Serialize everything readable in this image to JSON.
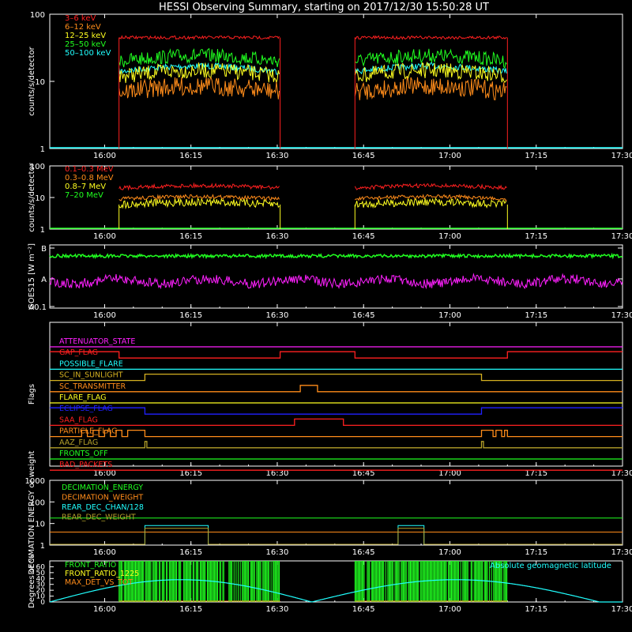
{
  "title": "HESSI Observing Summary, starting on 2017/12/30 15:50:28 UT",
  "colors": {
    "background": "#000000",
    "axes": "#ffffff",
    "red": "#ff2020",
    "orange": "#ff8c1a",
    "yellow": "#ffff20",
    "green": "#20ff20",
    "cyan": "#20ffff",
    "magenta": "#ff20ff",
    "blue": "#2020ff",
    "olive": "#b4a02a",
    "gold": "#d4b020"
  },
  "time_axis": {
    "range": [
      "15:50:28",
      "17:30"
    ],
    "tick_labels": [
      "16:00",
      "16:15",
      "16:30",
      "16:45",
      "17:00",
      "17:15",
      "17:30"
    ]
  },
  "chart_data": [
    {
      "id": "energy-lightcurves",
      "type": "line",
      "ylabel": "counts/s/detector",
      "yscale": "log",
      "ylim": [
        1,
        100
      ],
      "y_tick_labels": [
        "1",
        "10",
        "100"
      ],
      "time_intervals": [
        [
          "16:02:30",
          "16:30:30"
        ],
        [
          "16:43:30",
          "17:10:00"
        ]
      ],
      "series": [
        {
          "name": "3–6 keV",
          "color": "red",
          "level": 45
        },
        {
          "name": "6–12 keV",
          "color": "orange",
          "level": 7
        },
        {
          "name": "12–25 keV",
          "color": "yellow",
          "level": 12
        },
        {
          "name": "25–50 keV",
          "color": "green",
          "level": 20
        },
        {
          "name": "50–100 keV",
          "color": "cyan",
          "level": 14
        }
      ]
    },
    {
      "id": "mev-lightcurves",
      "type": "line",
      "ylabel": "counts/s/detector",
      "yscale": "log",
      "ylim": [
        1,
        100
      ],
      "y_tick_labels": [
        "1",
        "10",
        "100"
      ],
      "time_intervals": [
        [
          "16:02:30",
          "16:30:30"
        ],
        [
          "16:43:30",
          "17:10:00"
        ]
      ],
      "series": [
        {
          "name": "0.1–0.3 MeV",
          "color": "red",
          "level": 20
        },
        {
          "name": "0.3–0.8 MeV",
          "color": "orange",
          "level": 9
        },
        {
          "name": "0.8–7 MeV",
          "color": "yellow",
          "level": 6
        },
        {
          "name": "7–20 MeV",
          "color": "green",
          "level": 1
        }
      ]
    },
    {
      "id": "goes",
      "type": "line",
      "ylabel": "GOES15 [W m⁻²]",
      "y_tick_labels": [
        "A0.1",
        "A",
        "B"
      ],
      "series": [
        {
          "color": "green",
          "level": "B"
        },
        {
          "color": "magenta",
          "level": "A"
        }
      ]
    },
    {
      "id": "flags",
      "type": "line",
      "ylabel": "Flags",
      "rows": [
        {
          "name": "ATTENUATOR_STATE",
          "color": "magenta",
          "high": []
        },
        {
          "name": "GAP_FLAG",
          "color": "red",
          "high": [
            [
              "15:50:28",
              "16:02:30"
            ],
            [
              "16:30:30",
              "16:43:30"
            ],
            [
              "17:10:00",
              "17:30"
            ]
          ]
        },
        {
          "name": "POSSIBLE_FLARE",
          "color": "cyan",
          "high": []
        },
        {
          "name": "SC_IN_SUNLIGHT",
          "color": "gold",
          "high": [
            [
              "16:07:00",
              "17:05:30"
            ]
          ]
        },
        {
          "name": "SC_TRANSMITTER",
          "color": "orange",
          "high": [
            [
              "16:34:00",
              "16:37:00"
            ]
          ]
        },
        {
          "name": "FLARE_FLAG",
          "color": "yellow",
          "high": []
        },
        {
          "name": "ECLIPSE_FLAG",
          "color": "blue",
          "high": [
            [
              "15:50:28",
              "16:07:00"
            ],
            [
              "17:05:30",
              "17:30"
            ]
          ]
        },
        {
          "name": "SAA_FLAG",
          "color": "red",
          "high": [
            [
              "16:33:00",
              "16:41:30"
            ]
          ]
        },
        {
          "name": "PARTICLE_FLAG",
          "color": "orange",
          "high": [
            [
              "15:56:00",
              "15:57:00"
            ],
            [
              "15:58:00",
              "15:59:00"
            ],
            [
              "16:00:00",
              "16:01:00"
            ],
            [
              "16:02:00",
              "16:03:00"
            ],
            [
              "16:04:00",
              "16:07:00"
            ],
            [
              "17:05:30",
              "17:07:30"
            ],
            [
              "17:08:00",
              "17:09:00"
            ],
            [
              "17:09:30",
              "17:10:00"
            ]
          ]
        },
        {
          "name": "AAZ_FLAG",
          "color": "olive",
          "high": [
            [
              "16:07:00",
              "16:07:20"
            ],
            [
              "17:05:30",
              "17:05:50"
            ]
          ]
        },
        {
          "name": "FRONTS_OFF",
          "color": "green",
          "high": []
        },
        {
          "name": "BAD_PACKETS",
          "color": "red",
          "high": []
        }
      ]
    },
    {
      "id": "decimation",
      "type": "line",
      "ylabel": "DECIMATION ENERGY or weight",
      "yscale": "log",
      "ylim": [
        1,
        1000
      ],
      "y_tick_labels": [
        "1",
        "10",
        "100",
        "1000"
      ],
      "series": [
        {
          "name": "DECIMATION_ENERGY",
          "color": "green",
          "level": 18
        },
        {
          "name": "DECIMATION_WEIGHT",
          "color": "orange",
          "level": 4
        },
        {
          "name": "REAR_DEC_CHAN/128",
          "color": "cyan",
          "level": 8,
          "windows": [
            [
              "16:07:00",
              "16:18:00"
            ],
            [
              "16:51:00",
              "16:55:30"
            ]
          ]
        },
        {
          "name": "REAR_DEC_WEIGHT",
          "color": "olive",
          "level": 6,
          "windows": [
            [
              "16:07:00",
              "16:18:00"
            ],
            [
              "16:51:00",
              "16:55:30"
            ]
          ]
        }
      ]
    },
    {
      "id": "ratios",
      "type": "line",
      "ylabel": "Degrees or %",
      "ylim": [
        0,
        70
      ],
      "y_tick_labels": [
        "0",
        "10",
        "20",
        "30",
        "40",
        "50",
        "60"
      ],
      "time_intervals": [
        [
          "16:02:30",
          "16:30:30"
        ],
        [
          "16:43:30",
          "17:10:00"
        ]
      ],
      "series": [
        {
          "name": "FRONT_RATIO",
          "color": "green"
        },
        {
          "name": "FRONT_RATIO_1225",
          "color": "yellow"
        },
        {
          "name": "MAX_DET_VS_TOT",
          "color": "orange"
        },
        {
          "name": "Absolute geomagnetic latitude",
          "color": "cyan",
          "peaks": [
            38,
            38
          ],
          "troughs": [
            "15:50:28",
            "16:36:00",
            "17:26:00"
          ]
        }
      ]
    }
  ]
}
